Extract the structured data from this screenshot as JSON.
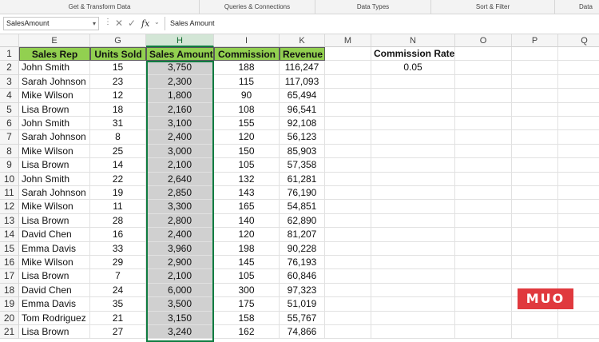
{
  "ribbon": {
    "groups": [
      "Get & Transform Data",
      "Queries & Connections",
      "Data Types",
      "Sort & Filter",
      "Data"
    ]
  },
  "formula_bar": {
    "name_box": "SalesAmount",
    "content": "Sales Amount",
    "fx_label": "fx"
  },
  "columns": [
    "E",
    "G",
    "H",
    "I",
    "K",
    "M",
    "N",
    "O",
    "P",
    "Q"
  ],
  "selected_column": "H",
  "header_row": [
    "Sales Rep",
    "Units Sold",
    "Sales Amount",
    "Commission",
    "Revenue"
  ],
  "commission_rate": {
    "label": "Commission Rate",
    "value": "0.05"
  },
  "rows": [
    [
      "John Smith",
      "15",
      "3,750",
      "188",
      "116,247"
    ],
    [
      "Sarah Johnson",
      "23",
      "2,300",
      "115",
      "117,093"
    ],
    [
      "Mike Wilson",
      "12",
      "1,800",
      "90",
      "65,494"
    ],
    [
      "Lisa Brown",
      "18",
      "2,160",
      "108",
      "96,541"
    ],
    [
      "John Smith",
      "31",
      "3,100",
      "155",
      "92,108"
    ],
    [
      "Sarah Johnson",
      "8",
      "2,400",
      "120",
      "56,123"
    ],
    [
      "Mike Wilson",
      "25",
      "3,000",
      "150",
      "85,903"
    ],
    [
      "Lisa Brown",
      "14",
      "2,100",
      "105",
      "57,358"
    ],
    [
      "John Smith",
      "22",
      "2,640",
      "132",
      "61,281"
    ],
    [
      "Sarah Johnson",
      "19",
      "2,850",
      "143",
      "76,190"
    ],
    [
      "Mike Wilson",
      "11",
      "3,300",
      "165",
      "54,851"
    ],
    [
      "Lisa Brown",
      "28",
      "2,800",
      "140",
      "62,890"
    ],
    [
      "David Chen",
      "16",
      "2,400",
      "120",
      "81,207"
    ],
    [
      "Emma Davis",
      "33",
      "3,960",
      "198",
      "90,228"
    ],
    [
      "Mike Wilson",
      "29",
      "2,900",
      "145",
      "76,193"
    ],
    [
      "Lisa Brown",
      "7",
      "2,100",
      "105",
      "60,846"
    ],
    [
      "David Chen",
      "24",
      "6,000",
      "300",
      "97,323"
    ],
    [
      "Emma Davis",
      "35",
      "3,500",
      "175",
      "51,019"
    ],
    [
      "Tom Rodriguez",
      "21",
      "3,150",
      "158",
      "55,767"
    ],
    [
      "Lisa Brown",
      "27",
      "3,240",
      "162",
      "74,866"
    ]
  ],
  "row_numbers": [
    "1",
    "2",
    "3",
    "4",
    "5",
    "6",
    "7",
    "8",
    "9",
    "10",
    "11",
    "12",
    "13",
    "14",
    "15",
    "16",
    "17",
    "18",
    "19",
    "20",
    "21"
  ],
  "watermark": "MUO",
  "colors": {
    "header_fill": "#92d050",
    "selection": "#107c41",
    "selected_fill": "#d0d0d0",
    "logo": "#e0393e"
  }
}
